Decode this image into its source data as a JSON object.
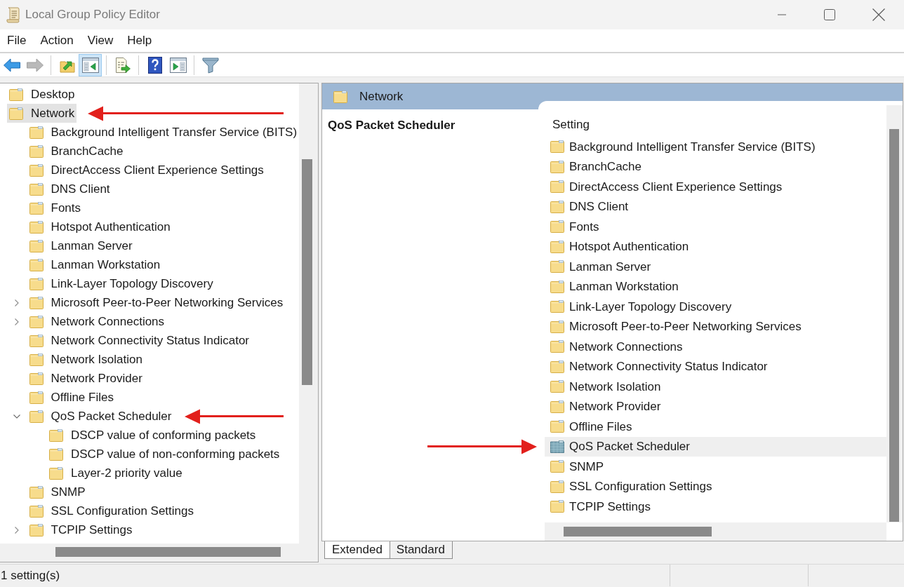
{
  "window": {
    "title": "Local Group Policy Editor",
    "controls": [
      {
        "kind": "minimize"
      },
      {
        "kind": "maximize"
      },
      {
        "kind": "close"
      }
    ]
  },
  "menu": [
    "File",
    "Action",
    "View",
    "Help"
  ],
  "toolbar": {
    "groups": [
      {
        "buttons": [
          {
            "kind": "back",
            "selected": false,
            "disabled": false
          },
          {
            "kind": "forward",
            "selected": false,
            "disabled": true
          }
        ]
      },
      {
        "buttons": [
          {
            "kind": "up",
            "selected": false,
            "disabled": false
          },
          {
            "kind": "console_tree",
            "selected": true,
            "disabled": false
          }
        ]
      },
      {
        "buttons": [
          {
            "kind": "export",
            "selected": false,
            "disabled": false
          }
        ]
      },
      {
        "buttons": [
          {
            "kind": "help",
            "selected": false,
            "disabled": false
          },
          {
            "kind": "action_pane",
            "selected": false,
            "disabled": false
          }
        ]
      },
      {
        "buttons": [
          {
            "kind": "filter",
            "selected": false,
            "disabled": false
          }
        ]
      }
    ]
  },
  "tree": [
    {
      "label": "Desktop",
      "selected": false,
      "annotated": false
    },
    {
      "label": "Network",
      "selected": true,
      "annotated": true,
      "children": [
        {
          "label": "Background Intelligent Transfer Service (BITS)",
          "selected": false,
          "annotated": false
        },
        {
          "label": "BranchCache",
          "selected": false,
          "annotated": false
        },
        {
          "label": "DirectAccess Client Experience Settings",
          "selected": false,
          "annotated": false
        },
        {
          "label": "DNS Client",
          "selected": false,
          "annotated": false
        },
        {
          "label": "Fonts",
          "selected": false,
          "annotated": false
        },
        {
          "label": "Hotspot Authentication",
          "selected": false,
          "annotated": false
        },
        {
          "label": "Lanman Server",
          "selected": false,
          "annotated": false
        },
        {
          "label": "Lanman Workstation",
          "selected": false,
          "annotated": false
        },
        {
          "label": "Link-Layer Topology Discovery",
          "selected": false,
          "annotated": false
        },
        {
          "label": "Microsoft Peer-to-Peer Networking Services",
          "expanded": false,
          "selected": false,
          "annotated": false
        },
        {
          "label": "Network Connections",
          "expanded": false,
          "selected": false,
          "annotated": false
        },
        {
          "label": "Network Connectivity Status Indicator",
          "selected": false,
          "annotated": false
        },
        {
          "label": "Network Isolation",
          "selected": false,
          "annotated": false
        },
        {
          "label": "Network Provider",
          "selected": false,
          "annotated": false
        },
        {
          "label": "Offline Files",
          "selected": false,
          "annotated": false
        },
        {
          "label": "QoS Packet Scheduler",
          "expanded": true,
          "selected": false,
          "annotated": true,
          "children": [
            {
              "label": "DSCP value of conforming packets",
              "selected": false,
              "annotated": false
            },
            {
              "label": "DSCP value of non-conforming packets",
              "selected": false,
              "annotated": false
            },
            {
              "label": "Layer-2 priority value",
              "selected": false,
              "annotated": false
            }
          ]
        },
        {
          "label": "SNMP",
          "selected": false,
          "annotated": false
        },
        {
          "label": "SSL Configuration Settings",
          "selected": false,
          "annotated": false
        },
        {
          "label": "TCPIP Settings",
          "expanded": false,
          "selected": false,
          "annotated": false
        }
      ]
    }
  ],
  "details": {
    "header": "Network",
    "description_title": "QoS Packet Scheduler",
    "column_header": "Setting",
    "items": [
      {
        "label": "Background Intelligent Transfer Service (BITS)",
        "selected": false,
        "annotated": false
      },
      {
        "label": "BranchCache",
        "selected": false,
        "annotated": false
      },
      {
        "label": "DirectAccess Client Experience Settings",
        "selected": false,
        "annotated": false
      },
      {
        "label": "DNS Client",
        "selected": false,
        "annotated": false
      },
      {
        "label": "Fonts",
        "selected": false,
        "annotated": false
      },
      {
        "label": "Hotspot Authentication",
        "selected": false,
        "annotated": false
      },
      {
        "label": "Lanman Server",
        "selected": false,
        "annotated": false
      },
      {
        "label": "Lanman Workstation",
        "selected": false,
        "annotated": false
      },
      {
        "label": "Link-Layer Topology Discovery",
        "selected": false,
        "annotated": false
      },
      {
        "label": "Microsoft Peer-to-Peer Networking Services",
        "selected": false,
        "annotated": false
      },
      {
        "label": "Network Connections",
        "selected": false,
        "annotated": false
      },
      {
        "label": "Network Connectivity Status Indicator",
        "selected": false,
        "annotated": false
      },
      {
        "label": "Network Isolation",
        "selected": false,
        "annotated": false
      },
      {
        "label": "Network Provider",
        "selected": false,
        "annotated": false
      },
      {
        "label": "Offline Files",
        "selected": false,
        "annotated": false
      },
      {
        "label": "QoS Packet Scheduler",
        "selected": true,
        "annotated": true
      },
      {
        "label": "SNMP",
        "selected": false,
        "annotated": false
      },
      {
        "label": "SSL Configuration Settings",
        "selected": false,
        "annotated": false
      },
      {
        "label": "TCPIP Settings",
        "selected": false,
        "annotated": false
      }
    ]
  },
  "view_tabs": [
    {
      "label": "Extended",
      "selected": true
    },
    {
      "label": "Standard",
      "selected": false
    }
  ],
  "status_bar": {
    "text": "1 setting(s)"
  }
}
